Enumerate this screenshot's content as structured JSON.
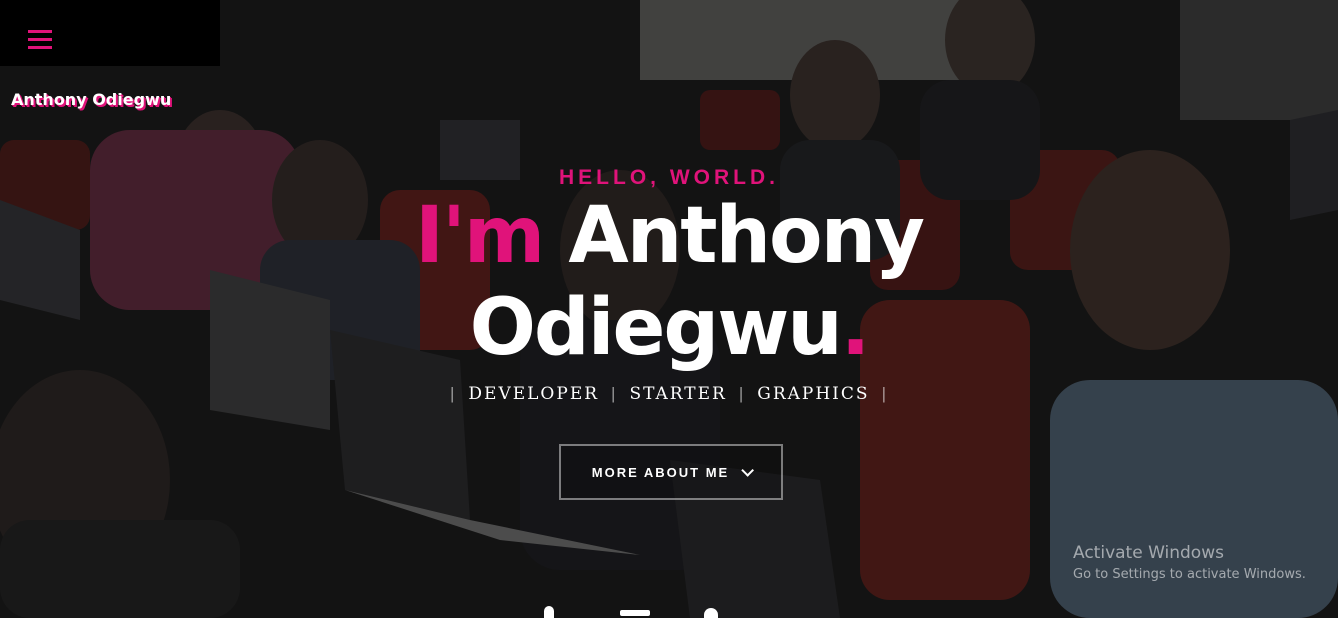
{
  "nav": {
    "menu_icon": "hamburger-menu-icon",
    "brand": "Anthony Odiegwu"
  },
  "hero": {
    "greeting": "HELLO, WORLD.",
    "intro_prefix": "I'm",
    "first_name": "Anthony",
    "last_name": "Odiegwu",
    "period": ".",
    "roles": [
      "DEVELOPER",
      "STARTER",
      "GRAPHICS"
    ],
    "separator": "|",
    "cta_label": "MORE ABOUT ME",
    "cta_icon": "chevron-down-icon"
  },
  "socials": [
    "social-icon-1",
    "social-icon-2",
    "social-icon-3"
  ],
  "os_watermark": {
    "title": "Activate Windows",
    "subtitle": "Go to Settings to activate Windows."
  },
  "colors": {
    "accent": "#e0137a",
    "text": "#ffffff",
    "menu_bg": "#000000"
  }
}
